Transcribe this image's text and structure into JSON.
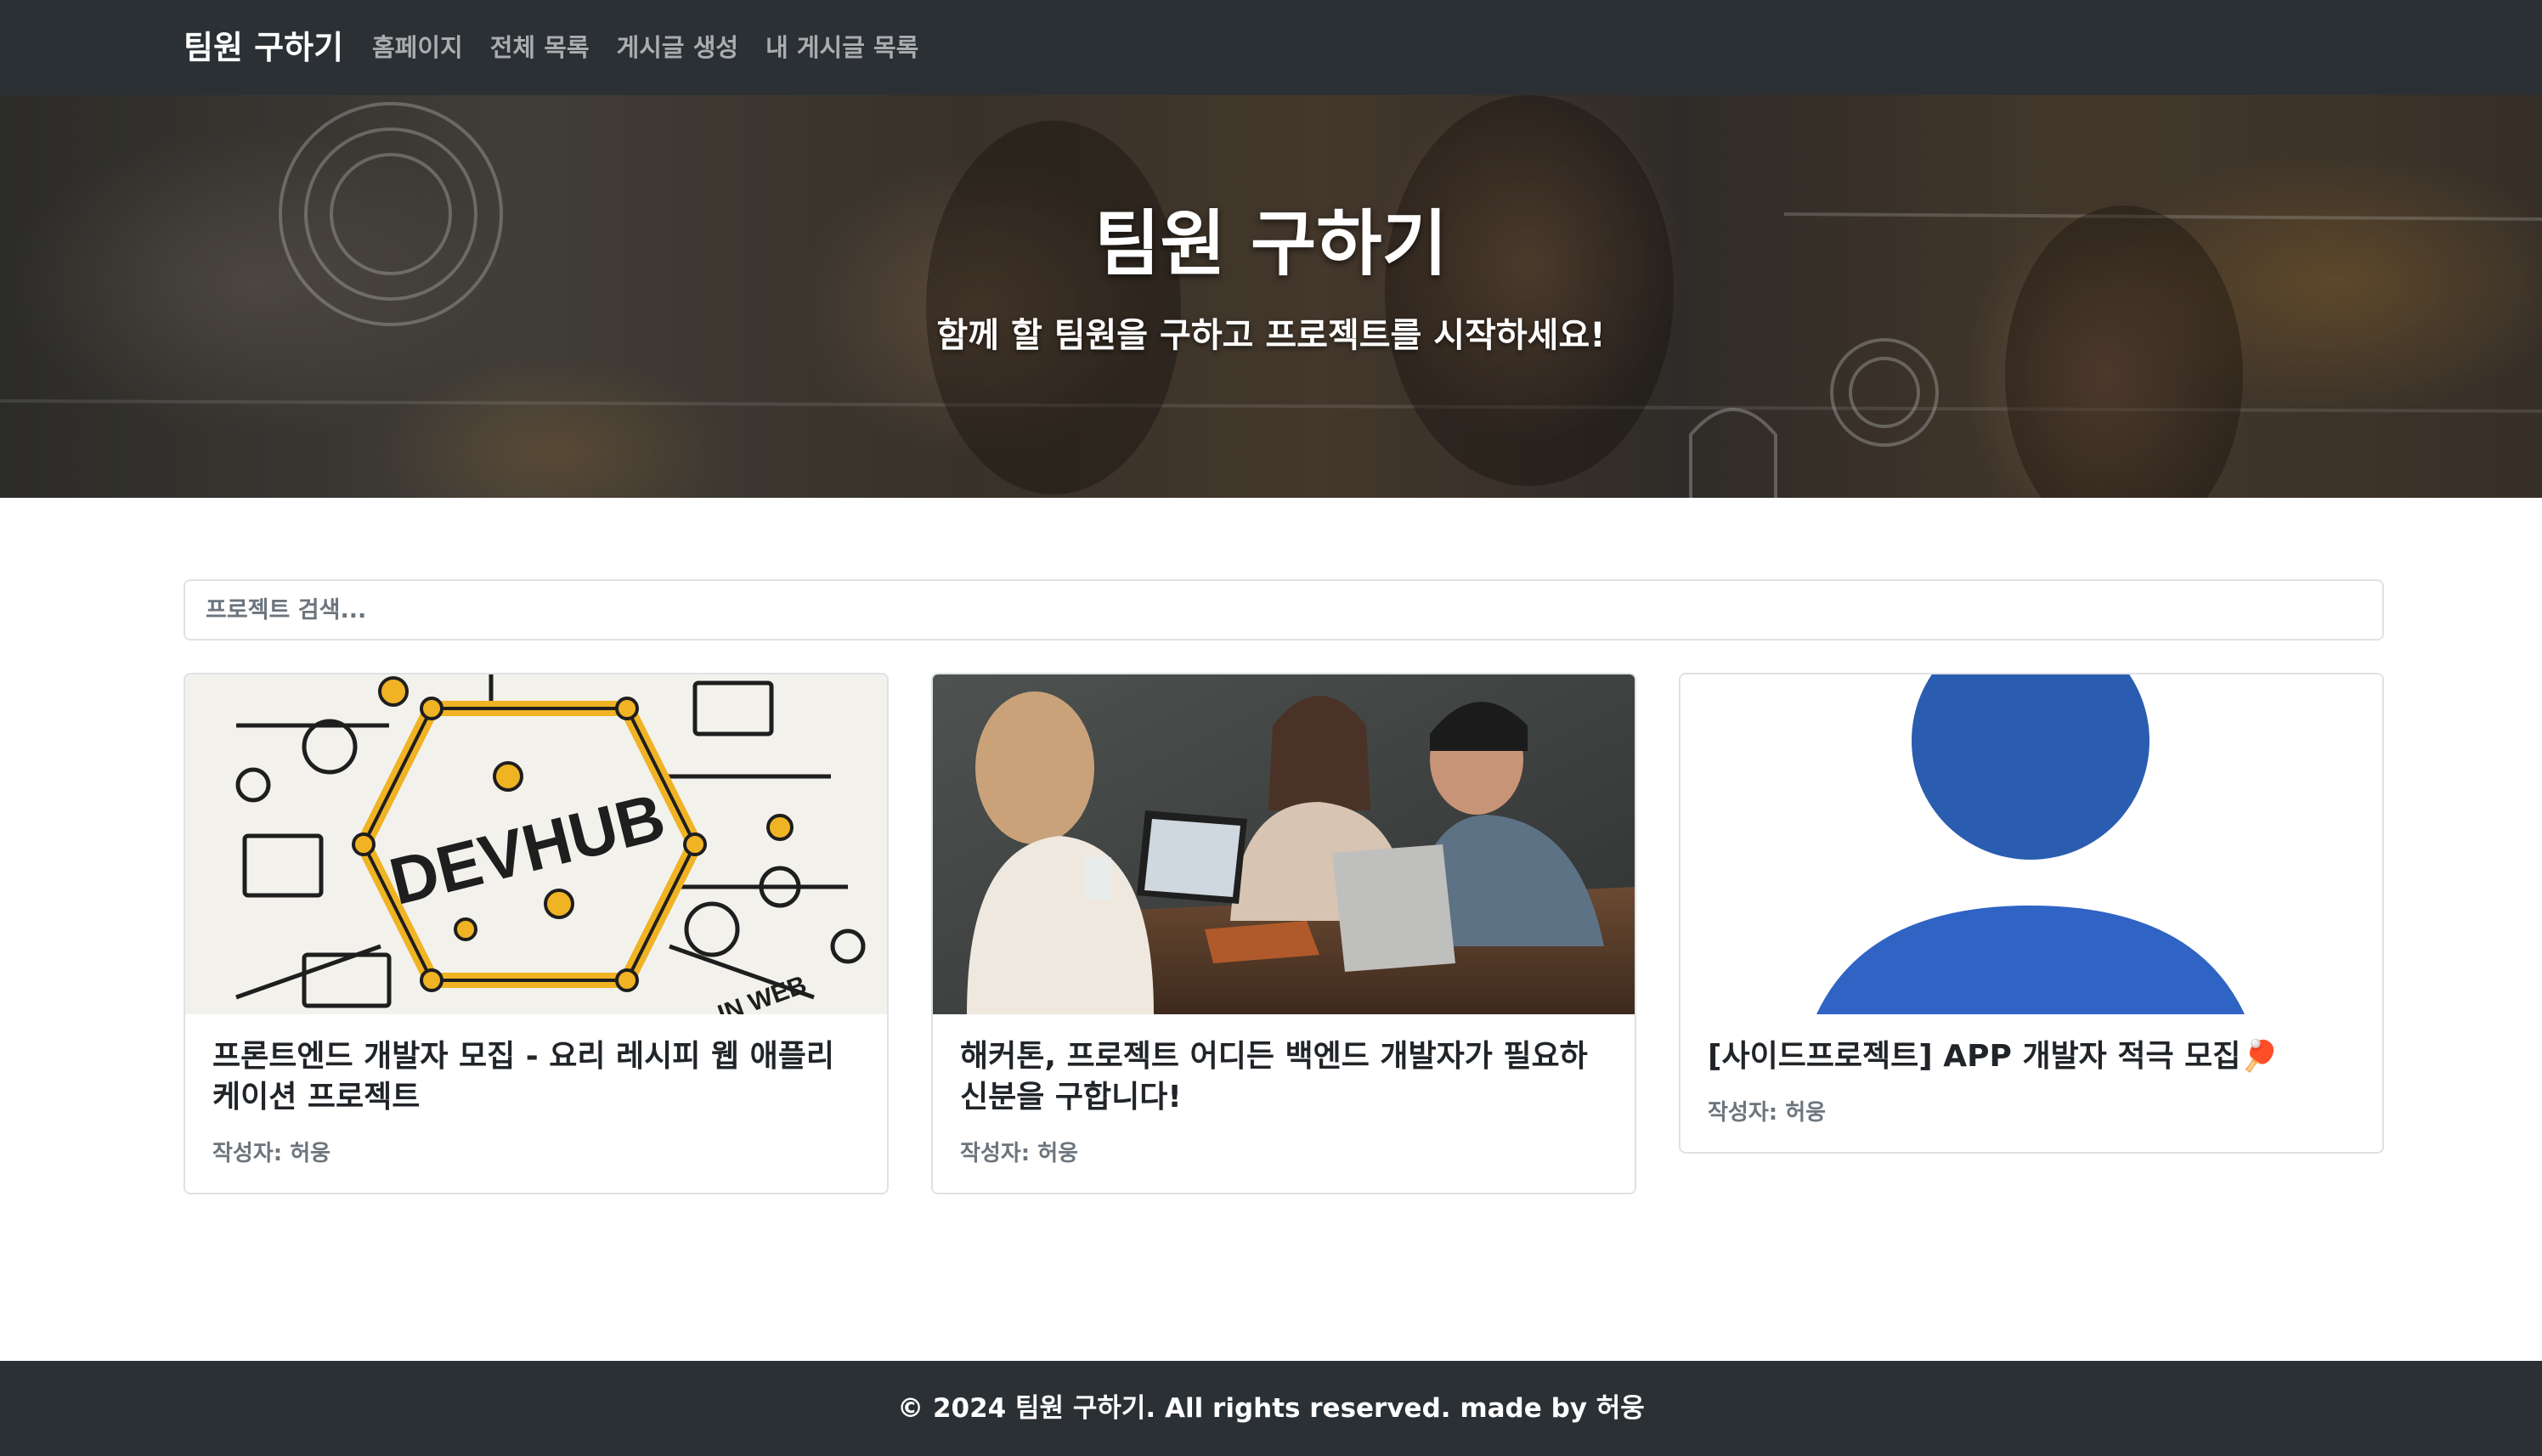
{
  "navbar": {
    "brand": "팀원 구하기",
    "links": [
      "홈페이지",
      "전체 목록",
      "게시글 생성",
      "내 게시글 목록"
    ]
  },
  "hero": {
    "title": "팀원 구하기",
    "subtitle": "함께 할 팀원을 구하고 프로젝트를 시작하세요!"
  },
  "search": {
    "placeholder": "프로젝트 검색...",
    "value": ""
  },
  "cards": [
    {
      "title": "프론트엔드 개발자 모집 - 요리 레시피 웹 애플리케이션 프로젝트",
      "author": "작성자: 허웅",
      "image": "devhub-illustration",
      "image_text": "DEVHUB",
      "image_caption": "IN WEB"
    },
    {
      "title": "해커톤, 프로젝트 어디든 백엔드 개발자가 필요하신분을 구합니다!",
      "author": "작성자: 허웅",
      "image": "team-meeting-photo"
    },
    {
      "title": "[사이드프로젝트] APP 개발자 적극 모집🏓",
      "author": "작성자: 허웅",
      "image": "user-avatar-placeholder"
    }
  ],
  "footer": {
    "text": "© 2024 팀원 구하기. All rights reserved. made by 허웅"
  },
  "colors": {
    "navbar_bg": "#2b3035",
    "footer_bg": "#2b3035",
    "muted_text": "#6c757d",
    "border": "#dee2e6",
    "avatar_blue": "#2f63c4"
  }
}
